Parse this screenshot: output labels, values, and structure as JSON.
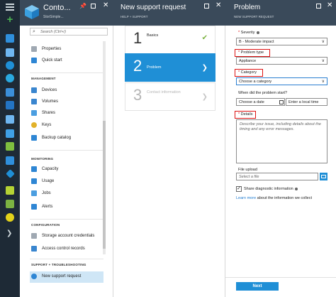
{
  "colors": {
    "nav_bg": "#1e2a36",
    "header_bg": "#3a4a5a",
    "accent": "#1f8fd6",
    "required": "#dd0000",
    "highlight_box": "#dd1111",
    "selected_row": "#cfe6f6",
    "check_green": "#7cb342"
  },
  "nav_icons": [
    "menu-icon",
    "plus-icon",
    "dashboard-icon",
    "grid-icon",
    "resource-groups-icon",
    "clock-icon",
    "globe-icon",
    "sql-icon",
    "storage-icon",
    "vm-icon",
    "load-balancer-icon",
    "network-icon",
    "diamond-icon",
    "shield-icon",
    "security-icon",
    "circle-icon",
    "chevron-right-icon"
  ],
  "blade1": {
    "title": "Conto...",
    "subtitle": "StorSimple...",
    "search_placeholder": "Search (Ctrl+/)",
    "top_items": [
      "Properties",
      "Quick start"
    ],
    "sections": [
      {
        "heading": "MANAGEMENT",
        "items": [
          "Devices",
          "Volumes",
          "Shares",
          "Keys",
          "Backup catalog"
        ]
      },
      {
        "heading": "MONITORING",
        "items": [
          "Capacity",
          "Usage",
          "Jobs",
          "Alerts"
        ]
      },
      {
        "heading": "CONFIGURATION",
        "items": [
          "Storage account credentials",
          "Access control records"
        ]
      },
      {
        "heading": "SUPPORT + TROUBLESHOOTING",
        "items": [
          "New support request"
        ]
      }
    ]
  },
  "blade2": {
    "title": "New support request",
    "subtitle": "HELP + SUPPORT",
    "steps": [
      {
        "num": "1",
        "label": "Basics",
        "state": "done"
      },
      {
        "num": "2",
        "label": "Problem",
        "state": "active"
      },
      {
        "num": "3",
        "label": "Contact information",
        "state": "pending"
      }
    ]
  },
  "blade3": {
    "title": "Problem",
    "subtitle": "NEW SUPPORT REQUEST",
    "severity_label": "Severity",
    "severity_value": "B - Moderate impact",
    "problem_type_label": "Problem type",
    "problem_type_value": "Appliance",
    "category_label": "Category",
    "category_value": "Choose a category",
    "when_label": "When did the problem start?",
    "date_value": "Choose a date",
    "time_value": "Enter a local time",
    "details_label": "Details",
    "details_placeholder": "Describe your issue, including details about the timing and any error messages.",
    "file_upload_label": "File upload",
    "file_placeholder": "Select a file",
    "share_diag_label": "Share diagnostic information",
    "learn_more_link": "Learn more",
    "learn_more_rest": "about the information we collect",
    "next_label": "Next"
  }
}
